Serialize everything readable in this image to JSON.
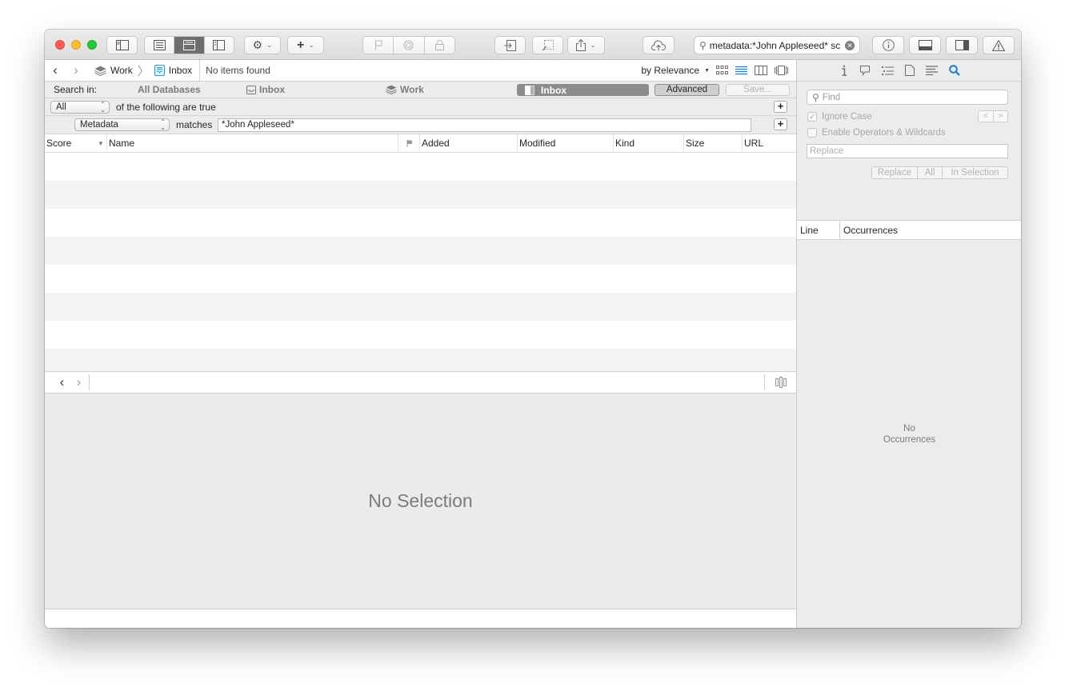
{
  "toolbar": {
    "search_value": "metadata:*John Appleseed* sc"
  },
  "path": {
    "database": "Work",
    "group": "Inbox",
    "status": "No items found",
    "sort_label": "by Relevance"
  },
  "scope": {
    "label": "Search in:",
    "all_databases": "All Databases",
    "inbox": "Inbox",
    "work": "Work",
    "selected": "Inbox",
    "advanced_label": "Advanced",
    "save_label": "Save..."
  },
  "criteria": {
    "match_mode": "All",
    "match_suffix": "of the following are true",
    "field": "Metadata",
    "operator": "matches",
    "value": "*John Appleseed*"
  },
  "columns": [
    "Score",
    "Name",
    "",
    "Added",
    "Modified",
    "Kind",
    "Size",
    "URL"
  ],
  "preview": {
    "empty_label": "No Selection"
  },
  "inspector": {
    "find_placeholder": "Find",
    "ignore_case": "Ignore Case",
    "operators": "Enable Operators & Wildcards",
    "replace_placeholder": "Replace",
    "replace_btn": "Replace",
    "all_btn": "All",
    "in_selection_btn": "In Selection",
    "col_line": "Line",
    "col_occurrences": "Occurrences",
    "empty_line1": "No",
    "empty_line2": "Occurrences"
  },
  "colors": {
    "accent": "#1a7cd6",
    "selected_scope": "#8c8c8c"
  }
}
